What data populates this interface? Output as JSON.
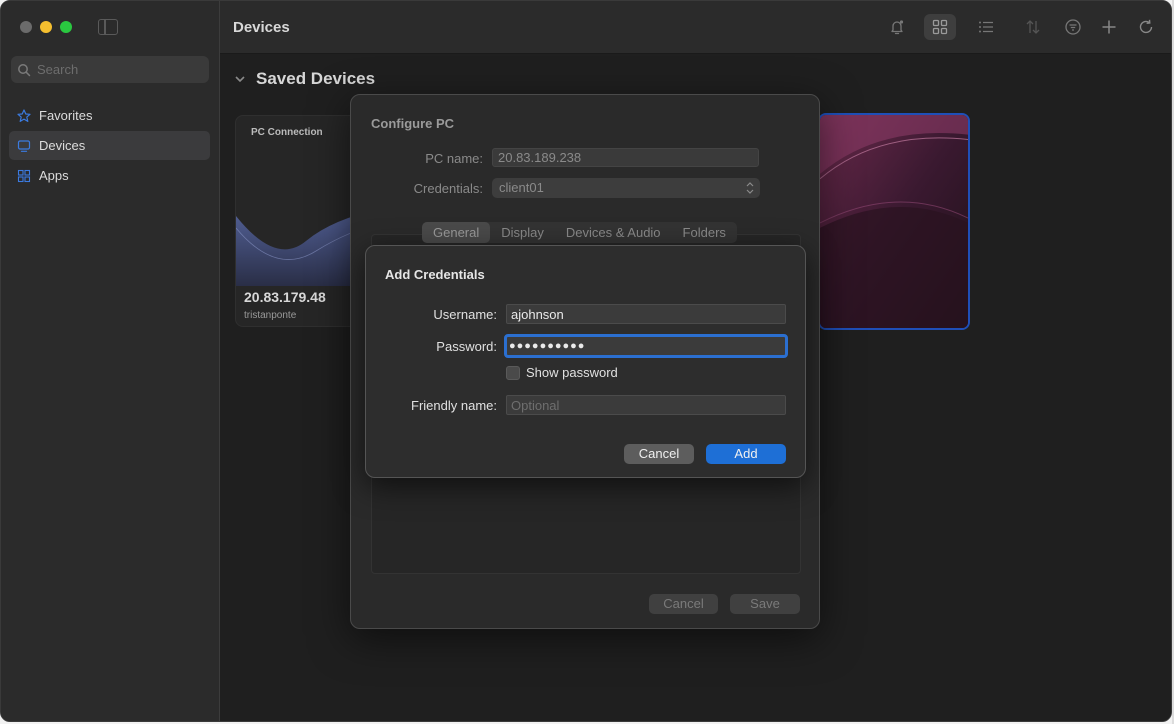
{
  "window": {
    "title": "Devices"
  },
  "sidebar": {
    "search_placeholder": "Search",
    "items": [
      {
        "label": "Favorites",
        "icon": "star-icon"
      },
      {
        "label": "Devices",
        "icon": "monitor-icon",
        "active": true
      },
      {
        "label": "Apps",
        "icon": "apps-grid-icon"
      }
    ]
  },
  "toolbar": {
    "icons": [
      "bell-icon",
      "grid-view-icon",
      "list-view-icon",
      "sort-icon",
      "filter-icon",
      "add-icon",
      "refresh-icon"
    ]
  },
  "main": {
    "section_title": "Saved Devices",
    "card_left": {
      "label": "PC Connection",
      "ip": "20.83.179.48",
      "user": "tristanponte"
    }
  },
  "configure_pc": {
    "title": "Configure PC",
    "pc_name_label": "PC name:",
    "pc_name_value": "20.83.189.238",
    "credentials_label": "Credentials:",
    "credentials_value": "client01",
    "tabs": [
      "General",
      "Display",
      "Devices & Audio",
      "Folders"
    ],
    "cancel_label": "Cancel",
    "save_label": "Save"
  },
  "add_credentials": {
    "title": "Add Credentials",
    "username_label": "Username:",
    "username_value": "ajohnson",
    "password_label": "Password:",
    "password_value": "●●●●●●●●●●",
    "show_password_label": "Show password",
    "friendly_name_label": "Friendly name:",
    "friendly_name_placeholder": "Optional",
    "cancel_label": "Cancel",
    "add_label": "Add"
  },
  "colors": {
    "accent": "#1e6fd6",
    "focus_ring": "#2b6fd0",
    "selected_card_border": "#1f4fb8"
  }
}
